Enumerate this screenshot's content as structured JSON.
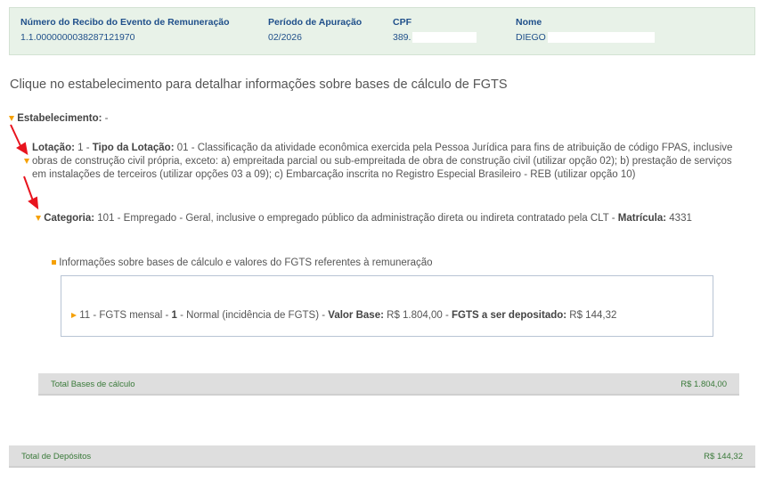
{
  "header": {
    "recibo_label": "Número do Recibo do Evento de Remuneração",
    "recibo_value": "1.1.0000000038287121970",
    "periodo_label": "Período de Apuração",
    "periodo_value": "02/2026",
    "cpf_label": "CPF",
    "cpf_value": "389.",
    "nome_label": "Nome",
    "nome_value": "DIEGO"
  },
  "intro": "Clique no estabelecimento para detalhar informações sobre bases de cálculo de FGTS",
  "estabelecimento": {
    "label": "Estabelecimento:",
    "value": " -"
  },
  "lotacao": {
    "label": "Lotação:",
    "value": " 1 - ",
    "tipo_label": "Tipo da Lotação:",
    "tipo_value": " 01 - Classificação da atividade econômica exercida pela Pessoa Jurídica para fins de atribuição de código FPAS, inclusive obras de construção civil própria, exceto: a) empreitada parcial ou sub-empreitada de obra de construção civil (utilizar opção 02); b) prestação de serviços em instalações de terceiros (utilizar opções 03 a 09); c) Embarcação inscrita no Registro Especial Brasileiro - REB (utilizar opção 10)"
  },
  "categoria": {
    "label": "Categoria:",
    "value": " 101 - Empregado - Geral, inclusive o empregado público da administração direta ou indireta contratado pela CLT - ",
    "matricula_label": "Matrícula:",
    "matricula_value": " 4331"
  },
  "info_bases": "Informações sobre bases de cálculo e valores do FGTS referentes à remuneração",
  "fgts_item": {
    "prefix": "11 - FGTS mensal - ",
    "code": "1",
    "desc": " - Normal (incidência de FGTS) - ",
    "valor_base_label": "Valor Base:",
    "valor_base_value": " R$ 1.804,00 - ",
    "fgts_dep_label": "FGTS a ser depositado:",
    "fgts_dep_value": " R$ 144,32"
  },
  "total_bases": {
    "label": "Total Bases de cálculo",
    "value": "R$ 1.804,00"
  },
  "total_depositos": {
    "label": "Total de Depósitos",
    "value": "R$ 144,32"
  },
  "colors": {
    "accent": "#f5a000",
    "header_bg": "#e8f2e8",
    "header_text": "#1f4f8a",
    "total_text": "#3a7a3a",
    "annotation": "#e8141e"
  }
}
